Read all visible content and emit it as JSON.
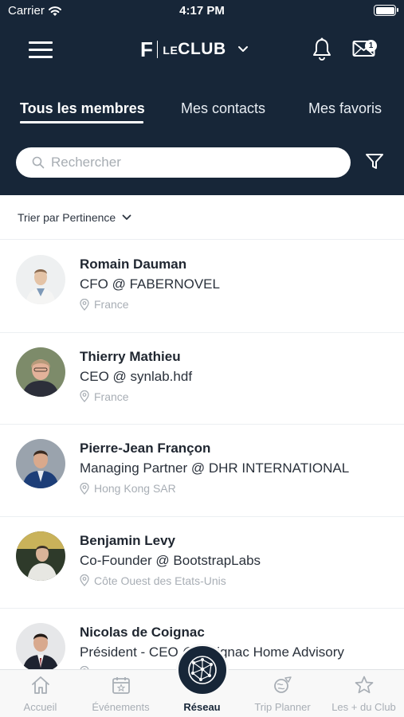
{
  "status_bar": {
    "carrier": "Carrier",
    "time": "4:17 PM"
  },
  "header": {
    "logo_letter": "F",
    "logo_le": "LE",
    "logo_club": "CLUB",
    "mail_badge": "1"
  },
  "tabs": [
    {
      "label": "Tous les membres",
      "active": true
    },
    {
      "label": "Mes contacts",
      "active": false
    },
    {
      "label": "Mes favoris",
      "active": false
    }
  ],
  "search": {
    "placeholder": "Rechercher"
  },
  "sort": {
    "label": "Trier par Pertinence"
  },
  "members": [
    {
      "name": "Romain Dauman",
      "role": "CFO @ FABERNOVEL",
      "location": "France"
    },
    {
      "name": "Thierry Mathieu",
      "role": "CEO @ synlab.hdf",
      "location": "France"
    },
    {
      "name": "Pierre-Jean Françon",
      "role": "Managing Partner @ DHR INTERNATIONAL",
      "location": "Hong Kong SAR"
    },
    {
      "name": "Benjamin Levy",
      "role": "Co-Founder @ BootstrapLabs",
      "location": "Côte Ouest des Etats-Unis"
    },
    {
      "name": "Nicolas de Coignac",
      "role": "Président - CEO @ Coignac Home Advisory",
      "location": ""
    }
  ],
  "tabbar": [
    {
      "label": "Accueil",
      "icon": "home-icon"
    },
    {
      "label": "Événements",
      "icon": "calendar-star-icon"
    },
    {
      "label": "Réseau",
      "icon": "network-globe-icon",
      "active": true
    },
    {
      "label": "Trip Planner",
      "icon": "trip-planner-icon"
    },
    {
      "label": "Les + du Club",
      "icon": "star-icon"
    }
  ],
  "colors": {
    "navy": "#172638",
    "muted": "#a8aeb5"
  }
}
